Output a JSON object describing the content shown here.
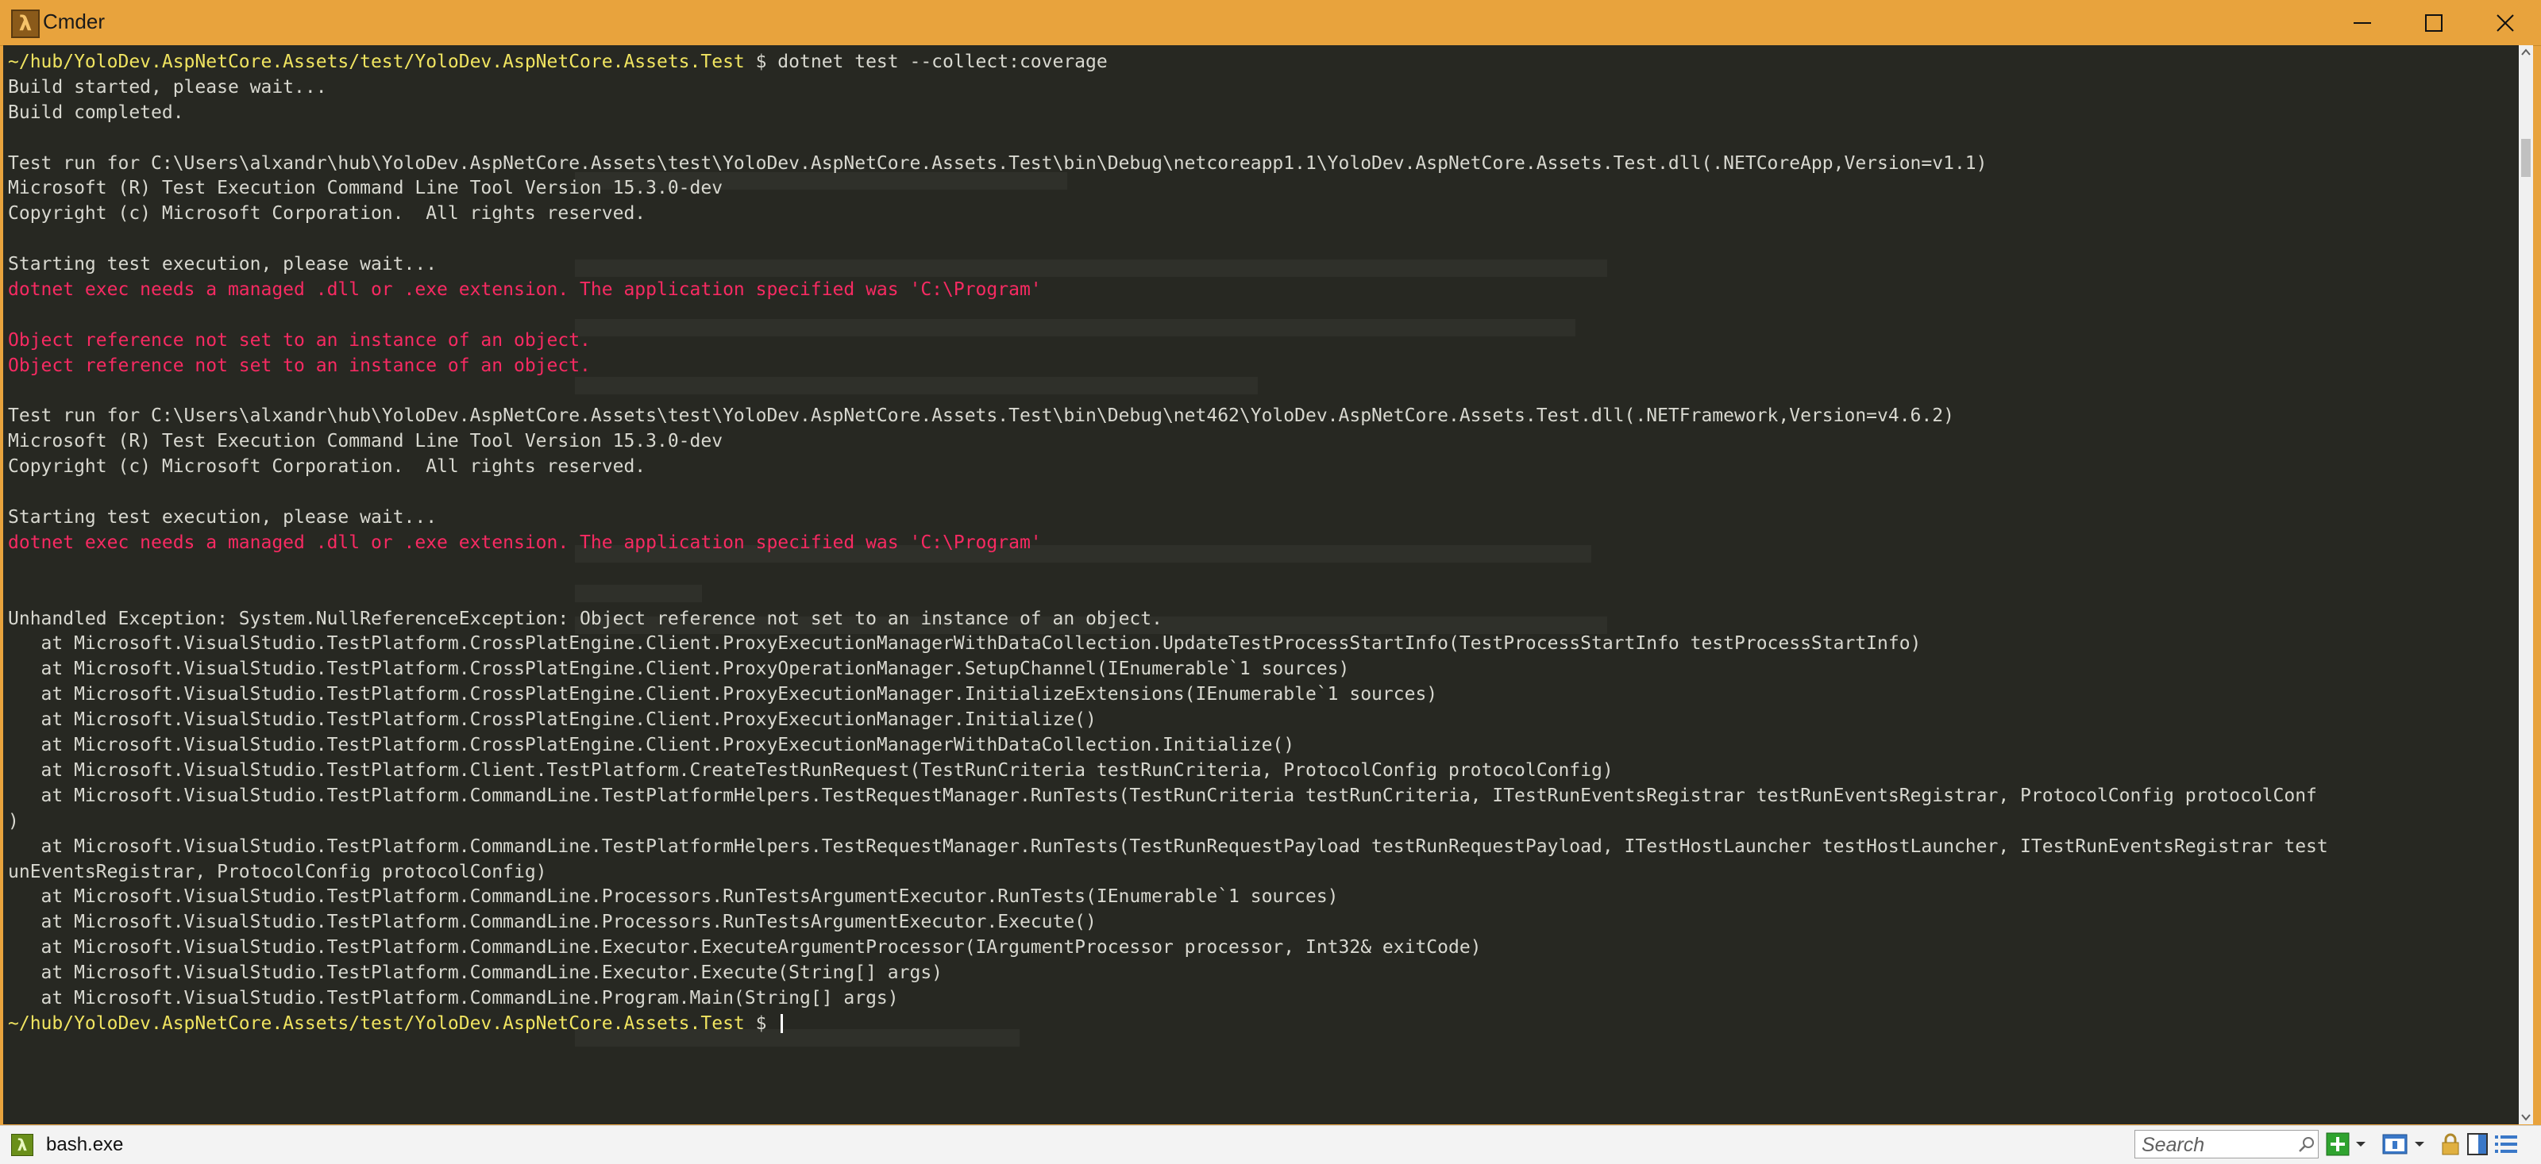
{
  "window": {
    "title": "Cmder",
    "app_icon_glyph": "λ",
    "minimize_icon": "minimize-icon",
    "maximize_icon": "maximize-icon",
    "close_icon": "close-icon"
  },
  "colors": {
    "titlebar": "#e8a33d",
    "console_bg": "#272822",
    "text": "#d8d8d0",
    "prompt_path": "#f0e460",
    "error": "#f72a62"
  },
  "console": {
    "lines": [
      {
        "segments": [
          {
            "t": "~/hub/YoloDev.AspNetCore.Assets/test/YoloDev.AspNetCore.Assets.Test",
            "c": "path"
          },
          {
            "t": " $ dotnet test --collect:coverage",
            "c": "normal"
          }
        ]
      },
      {
        "segments": [
          {
            "t": "Build started, please wait...",
            "c": "normal"
          }
        ]
      },
      {
        "segments": [
          {
            "t": "Build completed.",
            "c": "normal"
          }
        ]
      },
      {
        "segments": [
          {
            "t": "",
            "c": "normal"
          }
        ]
      },
      {
        "segments": [
          {
            "t": "Test run for C:\\Users\\alxandr\\hub\\YoloDev.AspNetCore.Assets\\test\\YoloDev.AspNetCore.Assets.Test\\bin\\Debug\\netcoreapp1.1\\YoloDev.AspNetCore.Assets.Test.dll(.NETCoreApp,Version=v1.1)",
            "c": "normal"
          }
        ]
      },
      {
        "segments": [
          {
            "t": "Microsoft (R) Test Execution Command Line Tool Version 15.3.0-dev",
            "c": "normal"
          }
        ]
      },
      {
        "segments": [
          {
            "t": "Copyright (c) Microsoft Corporation.  All rights reserved.",
            "c": "normal"
          }
        ]
      },
      {
        "segments": [
          {
            "t": "",
            "c": "normal"
          }
        ]
      },
      {
        "segments": [
          {
            "t": "Starting test execution, please wait...",
            "c": "normal"
          }
        ]
      },
      {
        "segments": [
          {
            "t": "dotnet exec needs a managed .dll or .exe extension. The application specified was 'C:\\Program'",
            "c": "err"
          }
        ]
      },
      {
        "segments": [
          {
            "t": "",
            "c": "normal"
          }
        ]
      },
      {
        "segments": [
          {
            "t": "Object reference not set to an instance of an object.",
            "c": "err"
          }
        ]
      },
      {
        "segments": [
          {
            "t": "Object reference not set to an instance of an object.",
            "c": "err"
          }
        ]
      },
      {
        "segments": [
          {
            "t": "",
            "c": "normal"
          }
        ]
      },
      {
        "segments": [
          {
            "t": "Test run for C:\\Users\\alxandr\\hub\\YoloDev.AspNetCore.Assets\\test\\YoloDev.AspNetCore.Assets.Test\\bin\\Debug\\net462\\YoloDev.AspNetCore.Assets.Test.dll(.NETFramework,Version=v4.6.2)",
            "c": "normal"
          }
        ]
      },
      {
        "segments": [
          {
            "t": "Microsoft (R) Test Execution Command Line Tool Version 15.3.0-dev",
            "c": "normal"
          }
        ]
      },
      {
        "segments": [
          {
            "t": "Copyright (c) Microsoft Corporation.  All rights reserved.",
            "c": "normal"
          }
        ]
      },
      {
        "segments": [
          {
            "t": "",
            "c": "normal"
          }
        ]
      },
      {
        "segments": [
          {
            "t": "Starting test execution, please wait...",
            "c": "normal"
          }
        ]
      },
      {
        "segments": [
          {
            "t": "dotnet exec needs a managed .dll or .exe extension. The application specified was 'C:\\Program'",
            "c": "err"
          }
        ]
      },
      {
        "segments": [
          {
            "t": "",
            "c": "normal"
          }
        ]
      },
      {
        "segments": [
          {
            "t": "",
            "c": "normal"
          }
        ]
      },
      {
        "segments": [
          {
            "t": "Unhandled Exception: System.NullReferenceException: Object reference not set to an instance of an object.",
            "c": "normal"
          }
        ]
      },
      {
        "segments": [
          {
            "t": "   at Microsoft.VisualStudio.TestPlatform.CrossPlatEngine.Client.ProxyExecutionManagerWithDataCollection.UpdateTestProcessStartInfo(TestProcessStartInfo testProcessStartInfo)",
            "c": "normal"
          }
        ]
      },
      {
        "segments": [
          {
            "t": "   at Microsoft.VisualStudio.TestPlatform.CrossPlatEngine.Client.ProxyOperationManager.SetupChannel(IEnumerable`1 sources)",
            "c": "normal"
          }
        ]
      },
      {
        "segments": [
          {
            "t": "   at Microsoft.VisualStudio.TestPlatform.CrossPlatEngine.Client.ProxyExecutionManager.InitializeExtensions(IEnumerable`1 sources)",
            "c": "normal"
          }
        ]
      },
      {
        "segments": [
          {
            "t": "   at Microsoft.VisualStudio.TestPlatform.CrossPlatEngine.Client.ProxyExecutionManager.Initialize()",
            "c": "normal"
          }
        ]
      },
      {
        "segments": [
          {
            "t": "   at Microsoft.VisualStudio.TestPlatform.CrossPlatEngine.Client.ProxyExecutionManagerWithDataCollection.Initialize()",
            "c": "normal"
          }
        ]
      },
      {
        "segments": [
          {
            "t": "   at Microsoft.VisualStudio.TestPlatform.Client.TestPlatform.CreateTestRunRequest(TestRunCriteria testRunCriteria, ProtocolConfig protocolConfig)",
            "c": "normal"
          }
        ]
      },
      {
        "segments": [
          {
            "t": "   at Microsoft.VisualStudio.TestPlatform.CommandLine.TestPlatformHelpers.TestRequestManager.RunTests(TestRunCriteria testRunCriteria, ITestRunEventsRegistrar testRunEventsRegistrar, ProtocolConfig protocolConf",
            "c": "normal"
          }
        ]
      },
      {
        "segments": [
          {
            "t": ")",
            "c": "normal"
          }
        ]
      },
      {
        "segments": [
          {
            "t": "   at Microsoft.VisualStudio.TestPlatform.CommandLine.TestPlatformHelpers.TestRequestManager.RunTests(TestRunRequestPayload testRunRequestPayload, ITestHostLauncher testHostLauncher, ITestRunEventsRegistrar test",
            "c": "normal"
          }
        ]
      },
      {
        "segments": [
          {
            "t": "unEventsRegistrar, ProtocolConfig protocolConfig)",
            "c": "normal"
          }
        ]
      },
      {
        "segments": [
          {
            "t": "   at Microsoft.VisualStudio.TestPlatform.CommandLine.Processors.RunTestsArgumentExecutor.RunTests(IEnumerable`1 sources)",
            "c": "normal"
          }
        ]
      },
      {
        "segments": [
          {
            "t": "   at Microsoft.VisualStudio.TestPlatform.CommandLine.Processors.RunTestsArgumentExecutor.Execute()",
            "c": "normal"
          }
        ]
      },
      {
        "segments": [
          {
            "t": "   at Microsoft.VisualStudio.TestPlatform.CommandLine.Executor.ExecuteArgumentProcessor(IArgumentProcessor processor, Int32& exitCode)",
            "c": "normal"
          }
        ]
      },
      {
        "segments": [
          {
            "t": "   at Microsoft.VisualStudio.TestPlatform.CommandLine.Executor.Execute(String[] args)",
            "c": "normal"
          }
        ]
      },
      {
        "segments": [
          {
            "t": "   at Microsoft.VisualStudio.TestPlatform.CommandLine.Program.Main(String[] args)",
            "c": "normal"
          }
        ]
      },
      {
        "segments": [
          {
            "t": "~/hub/YoloDev.AspNetCore.Assets/test/YoloDev.AspNetCore.Assets.Test",
            "c": "path"
          },
          {
            "t": " $ ",
            "c": "normal"
          }
        ],
        "cursor": true
      }
    ]
  },
  "statusbar": {
    "tab_icon_glyph": "λ",
    "tab_label": "bash.exe",
    "search_placeholder": "Search",
    "search_icon": "search-icon",
    "new_console_icon": "plus-icon",
    "tabs_icon": "tabs-icon",
    "lock_icon": "lock-icon",
    "split_icon": "split-icon",
    "menu_icon": "hamburger-menu-icon"
  }
}
